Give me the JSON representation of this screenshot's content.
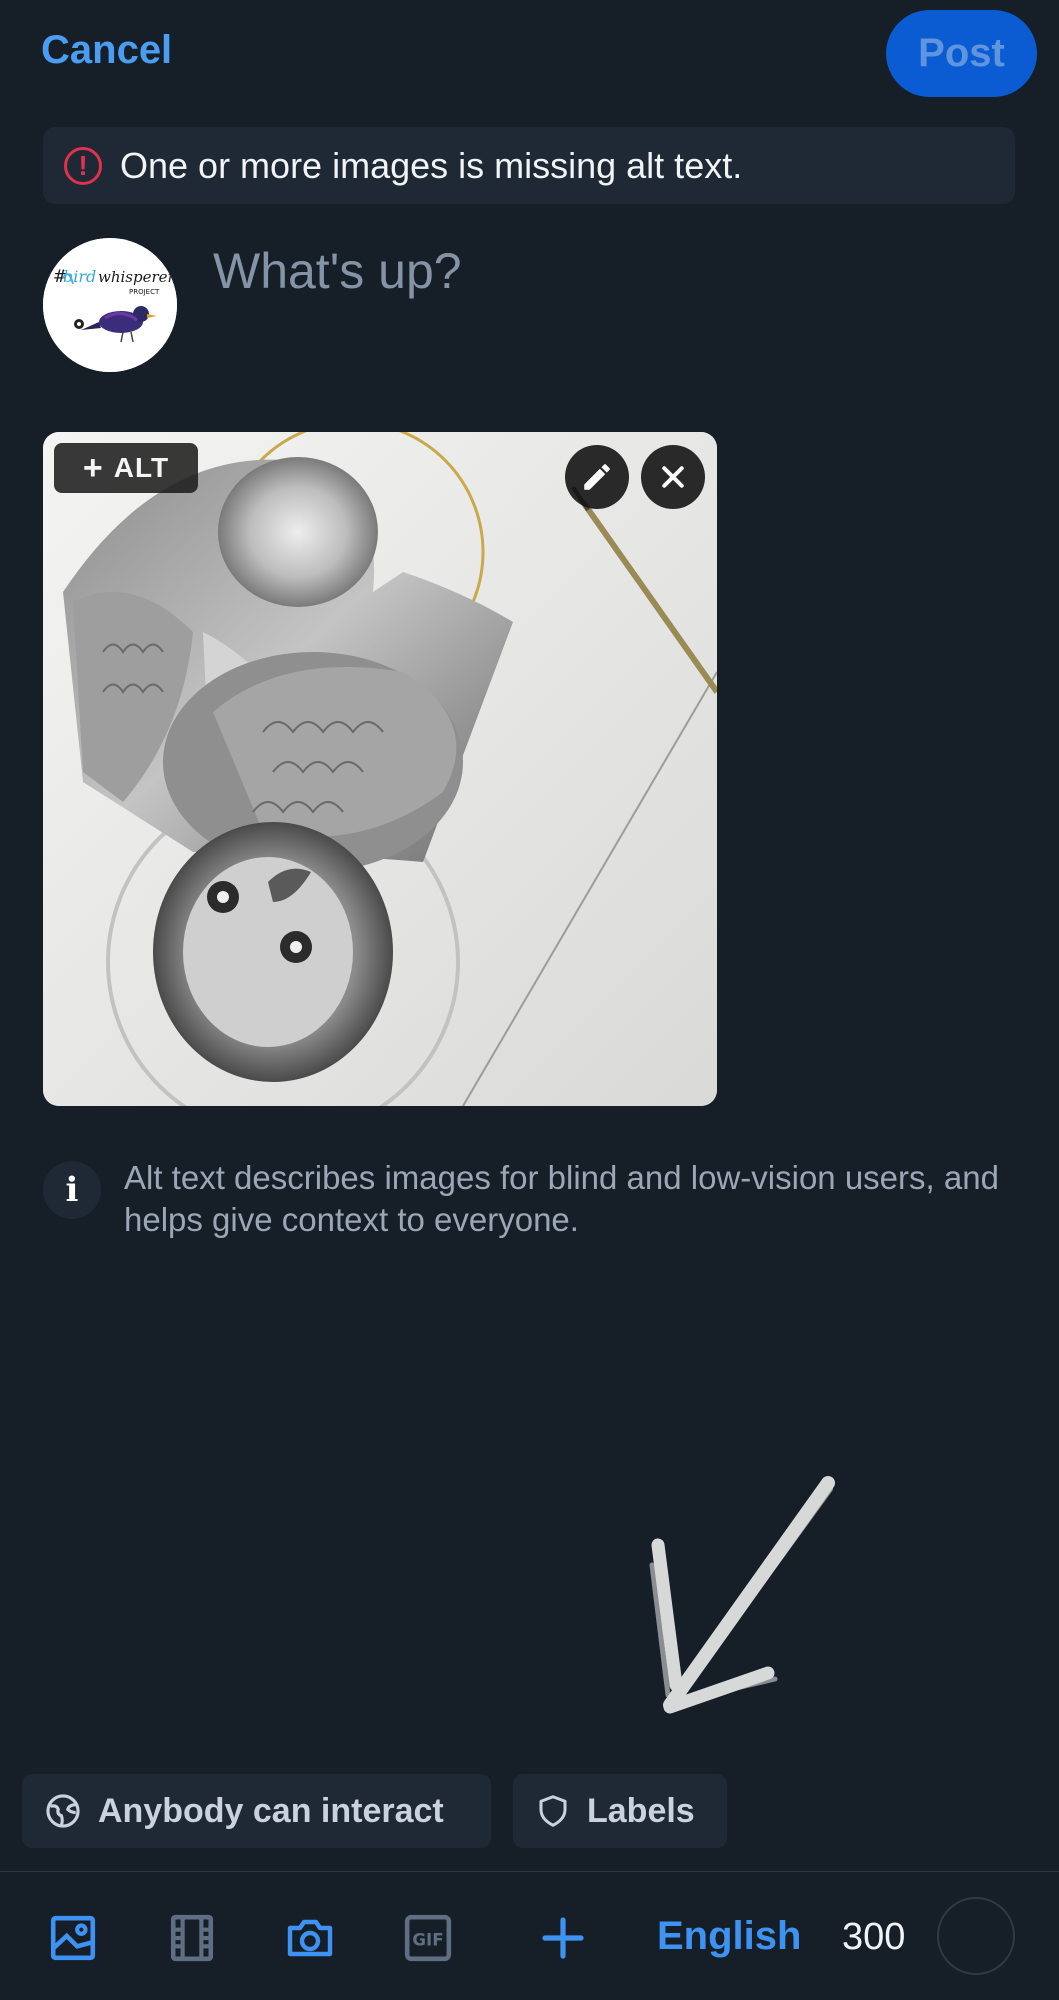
{
  "header": {
    "cancel_label": "Cancel",
    "post_label": "Post"
  },
  "warning": {
    "icon": "exclamation-circle-icon",
    "text": "One or more images is missing alt text."
  },
  "composer": {
    "placeholder": "What's up?",
    "value": ""
  },
  "avatar": {
    "logo_text": "#birdwhisperer PROJECT"
  },
  "attachment": {
    "alt_button_label": "ALT",
    "alt_button_icon": "plus-icon",
    "edit_icon": "pencil-icon",
    "remove_icon": "close-icon"
  },
  "info": {
    "icon": "info-icon",
    "text": "Alt text describes images for blind and low-vision users, and helps give context to everyone."
  },
  "chips": {
    "interaction_label": "Anybody can interact",
    "interaction_icon": "earth-icon",
    "labels_label": "Labels",
    "labels_icon": "shield-icon"
  },
  "toolbar": {
    "tools": [
      "gallery-icon",
      "video-icon",
      "camera-icon",
      "gif-icon",
      "plus-icon"
    ],
    "gif_text": "GIF",
    "language": "English",
    "char_remaining": "300",
    "char_progress": 0
  },
  "colors": {
    "background": "#161e27",
    "accent": "#3e93f2",
    "warning": "#e0314f"
  }
}
